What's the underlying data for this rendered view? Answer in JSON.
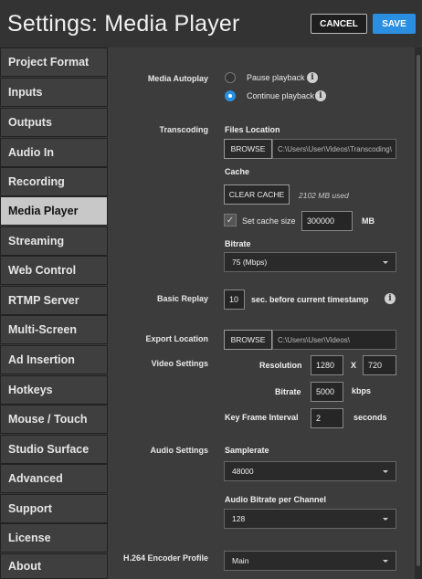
{
  "header": {
    "title": "Settings: Media Player",
    "cancel_label": "CANCEL",
    "save_label": "SAVE"
  },
  "sidebar": {
    "items": [
      "Project Format",
      "Inputs",
      "Outputs",
      "Audio In",
      "Recording",
      "Media Player",
      "Streaming",
      "Web Control",
      "RTMP Server",
      "Multi-Screen",
      "Ad Insertion",
      "Hotkeys",
      "Mouse / Touch",
      "Studio Surface",
      "Advanced",
      "Support",
      "License",
      "About"
    ],
    "active": "Media Player"
  },
  "media_autoplay": {
    "label": "Media Autoplay",
    "options": [
      "Pause playback",
      "Continue playback"
    ],
    "selected": "Continue playback"
  },
  "transcoding": {
    "label": "Transcoding",
    "files_location_label": "Files Location",
    "browse_label": "BROWSE",
    "path": "C:\\Users\\User\\Videos\\Transcoding\\",
    "cache_label": "Cache",
    "clear_cache_label": "CLEAR CACHE",
    "cache_used": "2102 MB used",
    "set_cache_label": "Set cache size",
    "cache_size": "300000",
    "cache_unit": "MB",
    "bitrate_label": "Bitrate",
    "bitrate_value": "75 (Mbps)"
  },
  "basic_replay": {
    "label": "Basic Replay",
    "seconds": "10",
    "suffix": "sec. before current timestamp"
  },
  "export_location": {
    "label": "Export Location",
    "browse_label": "BROWSE",
    "path": "C:\\Users\\User\\Videos\\"
  },
  "video_settings": {
    "label": "Video Settings",
    "resolution_label": "Resolution",
    "width": "1280",
    "x": "X",
    "height": "720",
    "bitrate_label": "Bitrate",
    "bitrate": "5000",
    "bitrate_unit": "kbps",
    "keyframe_label": "Key Frame Interval",
    "keyframe": "2",
    "keyframe_unit": "seconds"
  },
  "audio_settings": {
    "label": "Audio Settings",
    "samplerate_label": "Samplerate",
    "samplerate": "48000",
    "audio_bitrate_label": "Audio Bitrate per Channel",
    "audio_bitrate": "128"
  },
  "encoder_profile": {
    "label": "H.264 Encoder Profile",
    "value": "Main"
  },
  "colors": {
    "accent": "#2a8fe0",
    "background": "#3c3c3c",
    "sidebar_active": "#c8c8c8"
  }
}
